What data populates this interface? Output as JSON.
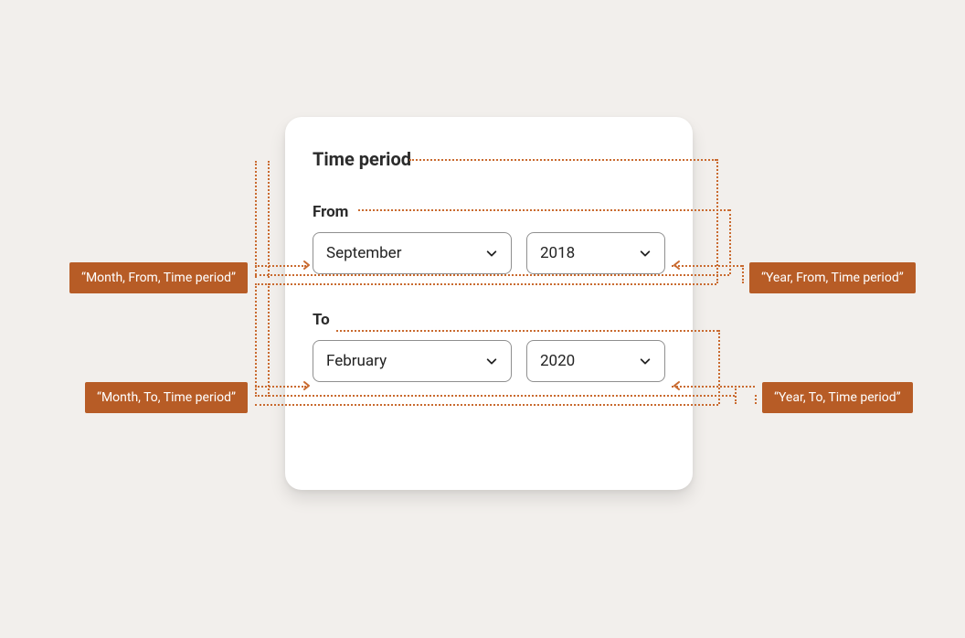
{
  "card": {
    "title": "Time period",
    "from": {
      "label": "From",
      "month": "September",
      "year": "2018"
    },
    "to": {
      "label": "To",
      "month": "February",
      "year": "2020"
    }
  },
  "annotations": {
    "month_from": "“Month, From, Time period”",
    "year_from": "“Year, From, Time period”",
    "month_to": "“Month, To, Time period”",
    "year_to": "“Year, To, Time period”"
  }
}
